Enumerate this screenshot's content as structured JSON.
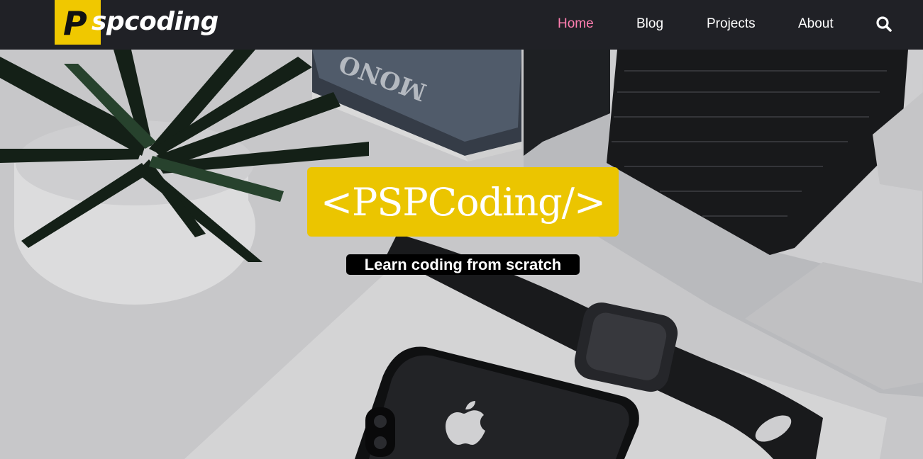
{
  "colors": {
    "nav_background": "#202126",
    "active_link": "#ff7eb0",
    "brand_yellow": "#ebc500",
    "text_white": "#ffffff"
  },
  "header": {
    "logo": {
      "mark": "P",
      "text": "spcoding"
    },
    "nav": [
      {
        "label": "Home",
        "active": true
      },
      {
        "label": "Blog",
        "active": false
      },
      {
        "label": "Projects",
        "active": false
      },
      {
        "label": "About",
        "active": false
      }
    ],
    "search_icon": "search-icon"
  },
  "hero": {
    "title": "<PSPCoding/>",
    "subtitle": "Learn coding from scratch",
    "background": "desk-photo-plant-laptop-watch-phone"
  }
}
